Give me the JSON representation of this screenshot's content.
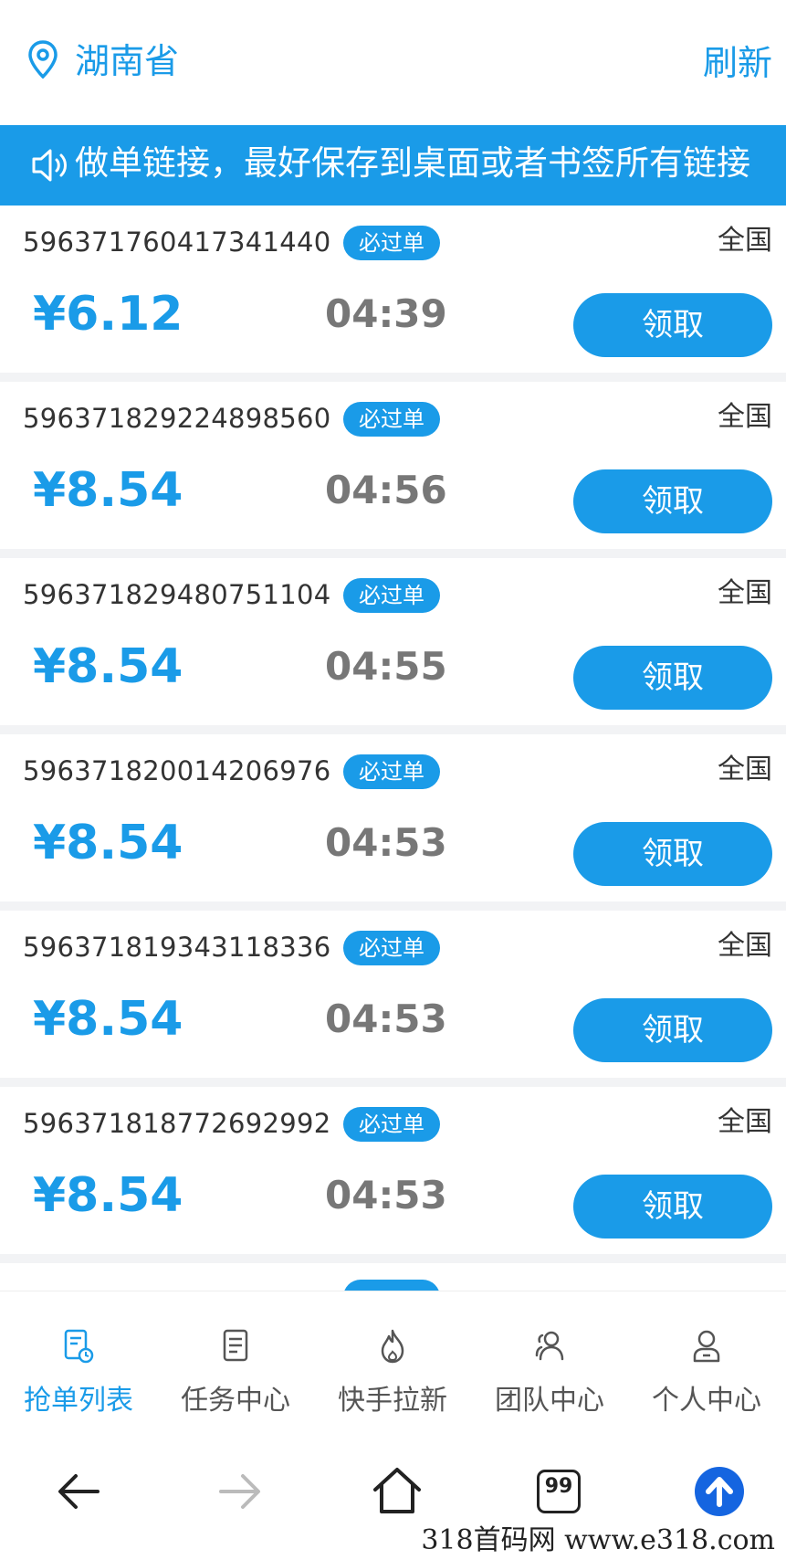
{
  "header": {
    "location": "湖南省",
    "refresh_label": "刷新"
  },
  "notice": {
    "text": "做单链接，最好保存到桌面或者书签所有链接"
  },
  "orders": [
    {
      "id": "596371760417341440",
      "badge": "必过单",
      "region": "全国",
      "price": "¥6.12",
      "time": "04:39",
      "action": "领取"
    },
    {
      "id": "596371829224898560",
      "badge": "必过单",
      "region": "全国",
      "price": "¥8.54",
      "time": "04:56",
      "action": "领取"
    },
    {
      "id": "596371829480751104",
      "badge": "必过单",
      "region": "全国",
      "price": "¥8.54",
      "time": "04:55",
      "action": "领取"
    },
    {
      "id": "596371820014206976",
      "badge": "必过单",
      "region": "全国",
      "price": "¥8.54",
      "time": "04:53",
      "action": "领取"
    },
    {
      "id": "596371819343118336",
      "badge": "必过单",
      "region": "全国",
      "price": "¥8.54",
      "time": "04:53",
      "action": "领取"
    },
    {
      "id": "596371818772692992",
      "badge": "必过单",
      "region": "全国",
      "price": "¥8.54",
      "time": "04:53",
      "action": "领取"
    }
  ],
  "tabs": [
    {
      "label": "抢单列表",
      "icon": "order-list-icon",
      "active": true
    },
    {
      "label": "任务中心",
      "icon": "document-icon",
      "active": false
    },
    {
      "label": "快手拉新",
      "icon": "flame-icon",
      "active": false
    },
    {
      "label": "团队中心",
      "icon": "team-icon",
      "active": false
    },
    {
      "label": "个人中心",
      "icon": "user-icon",
      "active": false
    }
  ],
  "browser_nav": {
    "tabs_count": "99"
  },
  "watermark": "318首码网  www.e318.com",
  "colors": {
    "accent": "#1a9be8",
    "time_gray": "#777777"
  }
}
